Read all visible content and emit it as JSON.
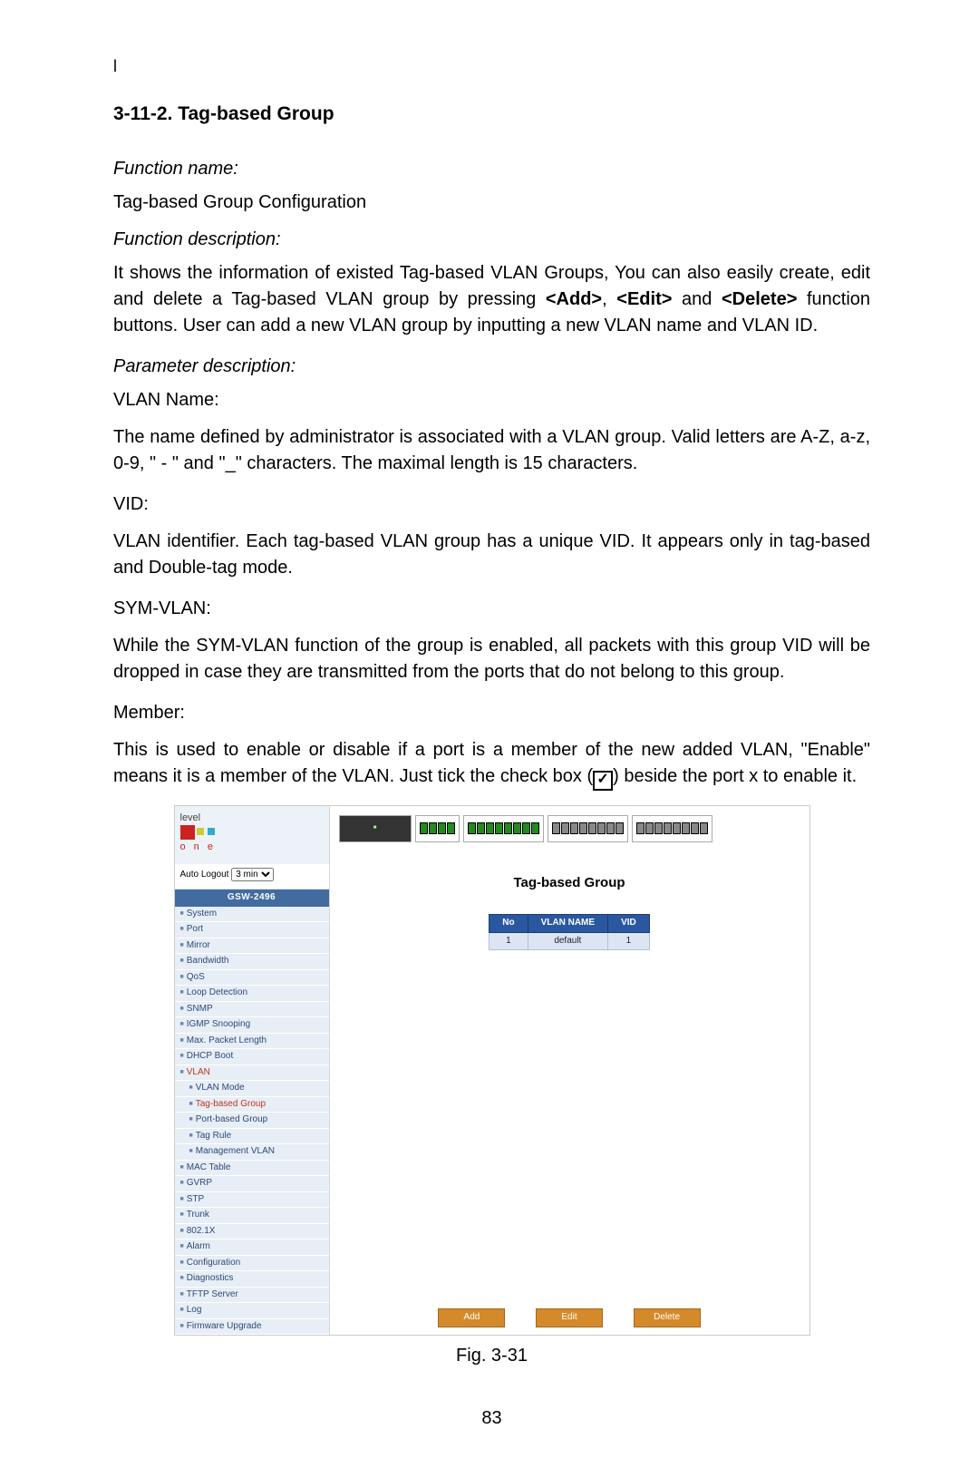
{
  "doc": {
    "top_mark": "l",
    "section_number": "3-11-2.",
    "section_title": "Tag-based Group",
    "fn_name_label": "Function name:",
    "fn_name_value": "Tag-based Group Configuration",
    "fn_desc_label": "Function description:",
    "fn_desc_text_before": "It shows the information of existed Tag-based VLAN Groups, You can also easily create, edit and delete a Tag-based VLAN group by pressing ",
    "fn_desc_add": "<Add>",
    "fn_desc_sep1": ", ",
    "fn_desc_edit": "<Edit>",
    "fn_desc_sep2": " and ",
    "fn_desc_delete": "<Delete>",
    "fn_desc_text_after": " function buttons. User can add a new VLAN group by inputting a new VLAN name and VLAN ID.",
    "param_label": "Parameter description:",
    "vlan_name_h": "VLAN Name:",
    "vlan_name_p": "The name defined by administrator is associated with a VLAN group. Valid letters are A-Z, a-z, 0-9, \" - \" and \"_\"  characters. The maximal length is 15 characters.",
    "vid_h": "VID:",
    "vid_p": "VLAN identifier. Each tag-based VLAN group has a unique VID. It appears only in tag-based and Double-tag mode.",
    "sym_h": "SYM-VLAN:",
    "sym_p": "While the SYM-VLAN function of the group is enabled, all packets with this group VID will be dropped in case they are transmitted from the ports that do not belong to this group.",
    "member_h": "Member:",
    "member_p_before": "This is used to enable or disable if a port is a member of the new added VLAN, \"Enable\" means it is a member of the VLAN. Just tick the check box (",
    "member_check": "✓",
    "member_p_after": ") beside the port x to enable it.",
    "fig_caption": "Fig. 3-31",
    "page_number": "83"
  },
  "app": {
    "logo_text": "level",
    "logo_sub": "o n e",
    "auto_logout_label": "Auto Logout",
    "auto_logout_value": "3 min",
    "model": "GSW-2496",
    "nav": [
      {
        "label": "System",
        "sub": false
      },
      {
        "label": "Port",
        "sub": false
      },
      {
        "label": "Mirror",
        "sub": false
      },
      {
        "label": "Bandwidth",
        "sub": false
      },
      {
        "label": "QoS",
        "sub": false
      },
      {
        "label": "Loop Detection",
        "sub": false
      },
      {
        "label": "SNMP",
        "sub": false
      },
      {
        "label": "IGMP Snooping",
        "sub": false
      },
      {
        "label": "Max. Packet Length",
        "sub": false
      },
      {
        "label": "DHCP Boot",
        "sub": false
      },
      {
        "label": "VLAN",
        "sub": false,
        "cat": true
      },
      {
        "label": "VLAN Mode",
        "sub": true
      },
      {
        "label": "Tag-based Group",
        "sub": true,
        "active": true
      },
      {
        "label": "Port-based Group",
        "sub": true
      },
      {
        "label": "Tag Rule",
        "sub": true
      },
      {
        "label": "Management VLAN",
        "sub": true
      },
      {
        "label": "MAC Table",
        "sub": false
      },
      {
        "label": "GVRP",
        "sub": false
      },
      {
        "label": "STP",
        "sub": false
      },
      {
        "label": "Trunk",
        "sub": false
      },
      {
        "label": "802.1X",
        "sub": false
      },
      {
        "label": "Alarm",
        "sub": false
      },
      {
        "label": "Configuration",
        "sub": false
      },
      {
        "label": "Diagnostics",
        "sub": false
      },
      {
        "label": "TFTP Server",
        "sub": false
      },
      {
        "label": "Log",
        "sub": false
      },
      {
        "label": "Firmware Upgrade",
        "sub": false
      }
    ],
    "content_title": "Tag-based Group",
    "table": {
      "headers": [
        "No",
        "VLAN NAME",
        "VID"
      ],
      "rows": [
        [
          "1",
          "default",
          "1"
        ]
      ]
    },
    "buttons": {
      "add": "Add",
      "edit": "Edit",
      "delete": "Delete"
    }
  }
}
